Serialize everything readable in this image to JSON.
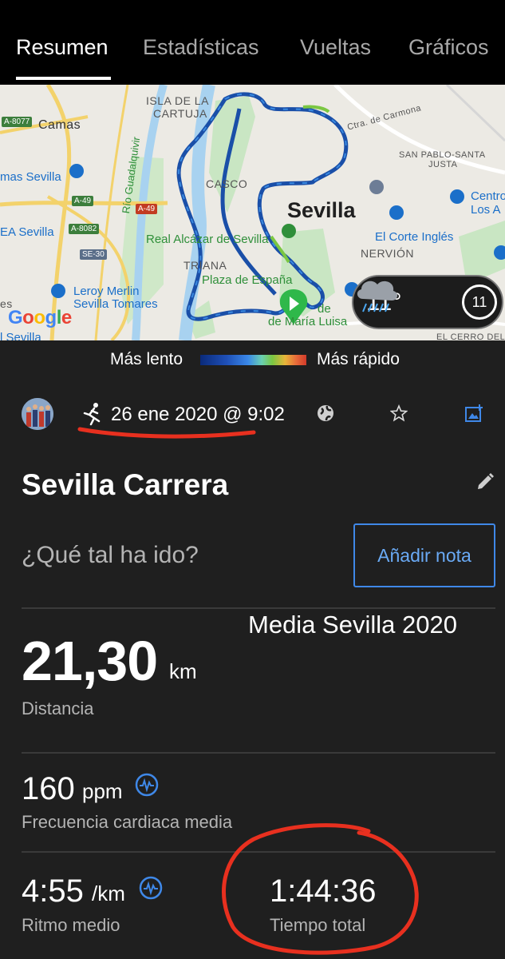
{
  "tabs": [
    {
      "label": "Resumen",
      "active": true
    },
    {
      "label": "Estadísticas",
      "active": false
    },
    {
      "label": "Vueltas",
      "active": false
    },
    {
      "label": "Gráficos",
      "active": false
    }
  ],
  "map": {
    "labels": {
      "isla": "ISLA DE LA",
      "cartuja": "CARTUJA",
      "camas": "Camas",
      "rio": "Río Guadalquivir",
      "carmona": "Ctra. de Carmona",
      "san_pablo": "SAN PABLO-SANTA",
      "justa": "JUSTA",
      "mas_sevilla": "mas Sevilla",
      "casco": "CASCO",
      "city": "Sevilla",
      "centro": "Centro",
      "los": "Los A",
      "ea_sevilla": "EA Sevilla",
      "real_alcazar": "Real Alcázar de Sevilla",
      "corte_ingles": "El Corte Inglés",
      "nervion": "NERVIÓN",
      "triana": "TRIANA",
      "plaza": "Plaza de España",
      "leroy1": "Leroy Merlin",
      "leroy2": "Sevilla Tomares",
      "maria_luisa": "de María Luisa",
      "parque_de": "de",
      "es": "es",
      "l_sevilla": "l Sevilla",
      "el_cerro": "EL CERRO DEL ÁGUILA",
      "google": "Google"
    },
    "road_tags": {
      "a8077": "A-8077",
      "a49a": "A-49",
      "a49b": "A-49",
      "a8082": "A-8082",
      "se30": "SE-30"
    },
    "weather": {
      "temperature": "11°",
      "wind": "11",
      "icon": "rain-cloud-icon"
    }
  },
  "legend": {
    "slow": "Más lento",
    "fast": "Más rápido"
  },
  "activity": {
    "date": "26 ene 2020 @ 9:02",
    "type_icon": "running-icon",
    "title": "Sevilla Carrera",
    "question": "¿Qué tal ha ido?",
    "add_note": "Añadir nota"
  },
  "annotation": {
    "handwritten_text": "Media Sevilla 2020"
  },
  "stats": {
    "distance": {
      "value": "21,30",
      "unit": "km",
      "label": "Distancia"
    },
    "heart_rate": {
      "value": "160",
      "unit": "ppm",
      "label": "Frecuencia cardiaca media"
    },
    "pace": {
      "value": "4:55",
      "unit": "/km",
      "label": "Ritmo medio"
    },
    "total_time": {
      "value": "1:44:36",
      "label": "Tiempo total"
    }
  },
  "colors": {
    "accent": "#3f88e8",
    "background": "#1f1f1f",
    "annotation": "#e8301f"
  }
}
